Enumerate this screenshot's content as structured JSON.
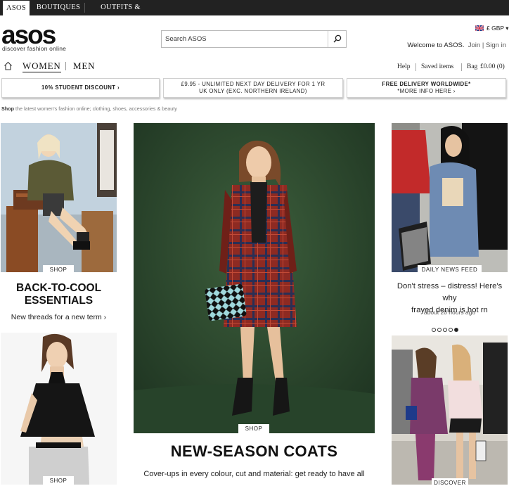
{
  "topbar": {
    "tabs": [
      {
        "label": "ASOS",
        "active": true
      },
      {
        "label": "BOUTIQUES",
        "active": false
      },
      {
        "label": "OUTFITS & LOOKS",
        "active": false
      }
    ]
  },
  "header": {
    "logo": "asos",
    "tagline": "discover fashion online",
    "search_placeholder": "Search ASOS",
    "currency": "£ GBP ▾",
    "welcome": "Welcome to ASOS.",
    "join": "Join",
    "sign_in": "Sign in"
  },
  "nav": {
    "women": "WOMEN",
    "men": "MEN",
    "help": "Help",
    "saved": "Saved items",
    "bag": "Bag",
    "bag_total": "£0.00 (0)"
  },
  "promos": [
    {
      "line1": "10% STUDENT DISCOUNT ›",
      "line2": "",
      "bold": "10%"
    },
    {
      "line1": "£9.95 - UNLIMITED NEXT DAY DELIVERY FOR 1 YR",
      "line2": "UK ONLY (EXC. NORTHERN IRELAND)",
      "bold": "£9.95"
    },
    {
      "line1": "FREE DELIVERY WORLDWIDE*",
      "line2": "*MORE INFO HERE ›",
      "bold": "FREE DELIVERY"
    }
  ],
  "shopline": {
    "bold": "Shop",
    "rest": "the latest women's fashion online; clothing, shoes, accessories & beauty"
  },
  "tiles": {
    "left_top": {
      "tag": "SHOP",
      "headline_1": "BACK-TO-COOL",
      "headline_2": "ESSENTIALS",
      "sub": "New threads for a new term ›"
    },
    "left_bottom": {
      "tag": "SHOP"
    },
    "center": {
      "tag": "SHOP",
      "headline": "NEW-SEASON COATS",
      "sub": "Cover-ups in every colour, cut and material: get ready to have all"
    },
    "right_top": {
      "tag": "DAILY NEWS FEED",
      "headline_1": "Don't stress – distress! Here's why",
      "headline_2": "frayed denim is hot rn",
      "time": "about 20 hours ago",
      "slides": 5,
      "active_slide": 5
    },
    "right_bottom": {
      "tag": "DISCOVER"
    }
  },
  "colors": {
    "topbar": "#222222",
    "center_bg": "#2c4a2f"
  }
}
